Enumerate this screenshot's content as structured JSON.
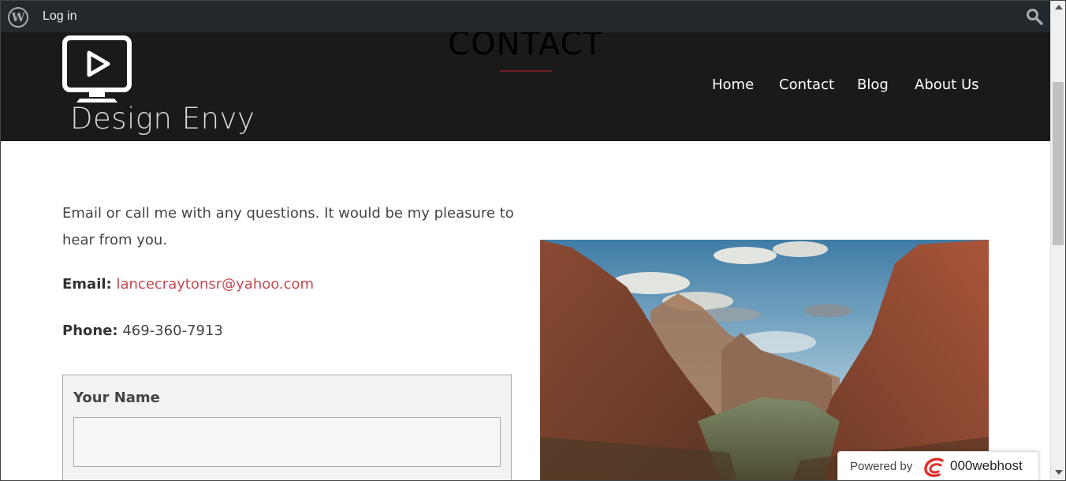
{
  "admin_bar": {
    "logo_icon": "wordpress-logo-icon",
    "login_label": "Log in",
    "search_icon": "search-icon"
  },
  "header": {
    "page_title": "CONTACT",
    "logo_text": "Design Envy",
    "logo_icon": "monitor-play-icon",
    "nav": [
      "Home",
      "Contact",
      "Blog",
      "About Us"
    ]
  },
  "content": {
    "intro": "Email or call me with any questions. It would be my pleasure to hear from you.",
    "email_label": "Email:",
    "email_value": "lancecraytonsr@yahoo.com",
    "phone_label": "Phone:",
    "phone_value": "469-360-7913"
  },
  "form": {
    "name_label": "Your Name",
    "name_value": ""
  },
  "badge": {
    "powered_text": "Powered by",
    "brand": "000webhost"
  },
  "colors": {
    "admin_bar": "#23282d",
    "header": "#1a1a1b",
    "link": "#c5494f",
    "accent_underline": "#6e1f25"
  }
}
